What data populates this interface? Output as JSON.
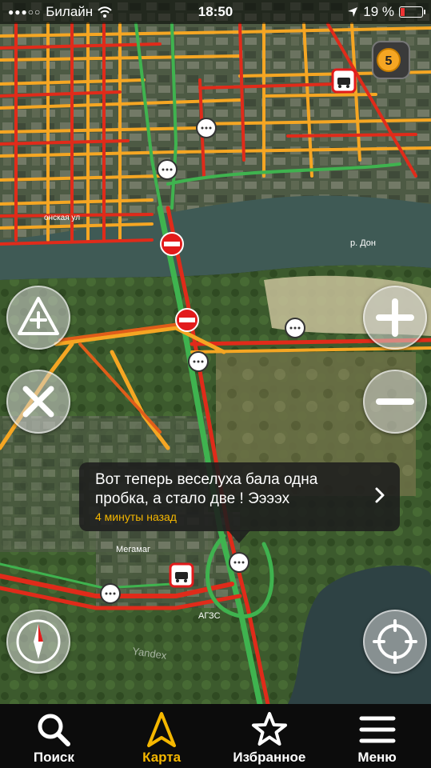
{
  "status_bar": {
    "carrier": "Билайн",
    "time": "18:50",
    "battery_percent": "19 %",
    "battery_level": 0.19
  },
  "map": {
    "labels": {
      "river": "р. Дон",
      "street": "онская ул",
      "store": "Мегамаг",
      "gas": "АГЗС",
      "watermark": "Yandex"
    },
    "traffic_score": "5",
    "colors": {
      "jam": "#e02b1a",
      "slow": "#f5a623",
      "free": "#3fb34f",
      "water": "#3f5a55"
    }
  },
  "popup": {
    "message": "Вот теперь веселуха бала одна пробка, а стало две ! Ээээх",
    "time_ago": "4 минуты назад"
  },
  "tabs": [
    {
      "label": "Поиск",
      "icon": "search-icon"
    },
    {
      "label": "Карта",
      "icon": "map-arrow-icon",
      "active": true
    },
    {
      "label": "Избранное",
      "icon": "star-icon"
    },
    {
      "label": "Меню",
      "icon": "menu-icon"
    }
  ]
}
